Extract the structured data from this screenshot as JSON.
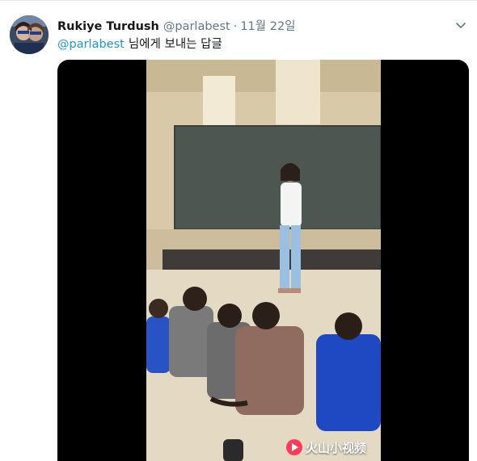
{
  "tweet": {
    "display_name": "Rukiye Turdush",
    "handle": "@parlabest",
    "separator": "·",
    "date": "11월 22일",
    "reply_to_mention": "@parlabest",
    "reply_to_suffix": "님에게 보내는 답글",
    "media_watermark": "火山小视频"
  },
  "colors": {
    "name": "#14171a",
    "secondary": "#657786",
    "link": "#1b95e0",
    "media_background": "#000000",
    "watermark_logo": "#ff3b5c"
  },
  "icons": {
    "caret": "chevron-down-icon",
    "watermark": "play-logo-icon"
  }
}
